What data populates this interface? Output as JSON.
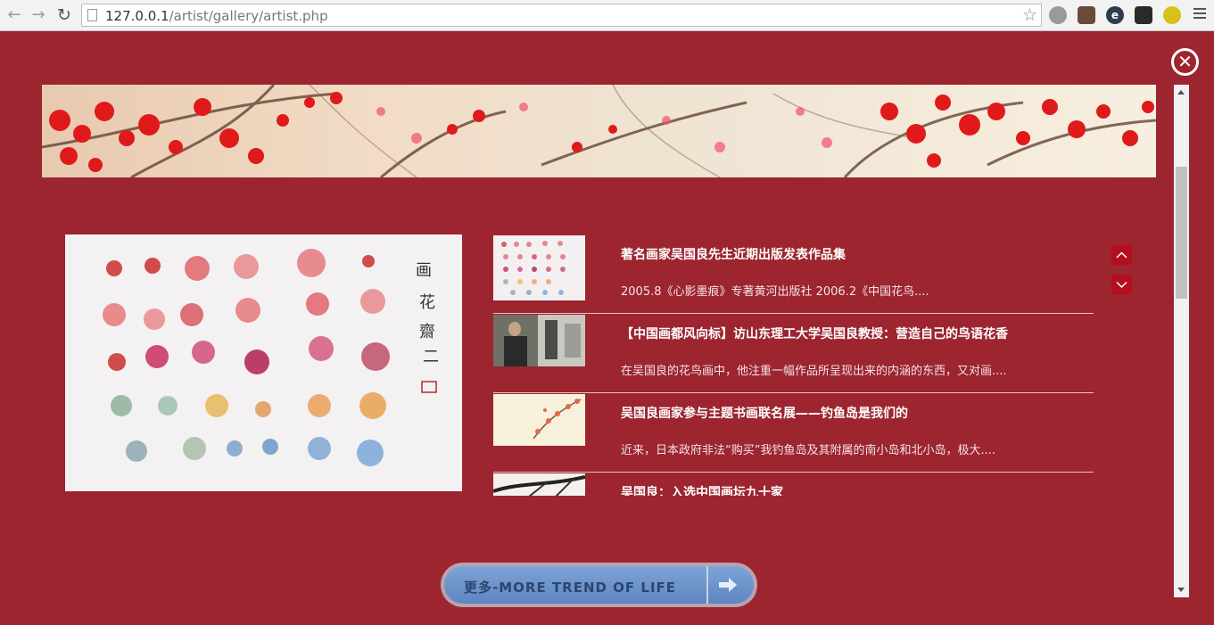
{
  "browser": {
    "url_host": "127.0.0.1",
    "url_path": "/artist/gallery/artist.php"
  },
  "news": [
    {
      "title": "著名画家吴国良先生近期出版发表作品集",
      "summary": "2005.8《心影墨痕》专著黄河出版社 2006.2《中国花鸟...."
    },
    {
      "title": "【中国画都风向标】访山东理工大学吴国良教授：营造自己的鸟语花香",
      "summary": "在吴国良的花鸟画中，他注重一幅作品所呈现出来的内涵的东西，又对画...."
    },
    {
      "title": "吴国良画家参与主题书画联名展——钓鱼岛是我们的",
      "summary": "近来，日本政府非法“购买”我钓鱼岛及其附属的南小岛和北小岛，极大...."
    },
    {
      "title": "吴国良：入选中国画坛九十家",
      "summary": ""
    }
  ],
  "more_button": {
    "label": "更多-MORE TREND OF LIFE"
  },
  "colors": {
    "page_bg": "#9c2530",
    "list_arrow_bg": "#b40e1f",
    "more_button_blue": "#6b93cb"
  }
}
